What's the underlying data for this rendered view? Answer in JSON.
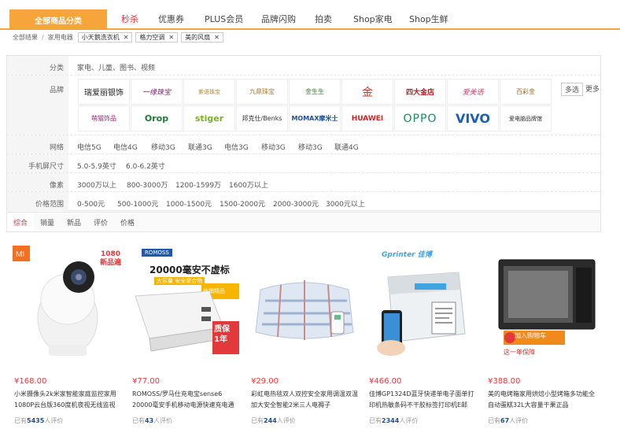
{
  "nav": {
    "all_label": "全部商品分类",
    "items": [
      "秒杀",
      "优惠券",
      "PLUS会员",
      "品牌闪购",
      "拍卖",
      "Shop家电",
      "Shop生鲜"
    ]
  },
  "breadcrumb": {
    "root": "全部结果",
    "category": "家用电器",
    "tags": [
      "小天鹅洗衣机",
      "格力空调",
      "美的风扇"
    ]
  },
  "filters": {
    "category": {
      "label": "分类",
      "options": [
        "家电、儿童、图书、视频"
      ]
    },
    "brand": {
      "label": "品牌",
      "more_select": "多选",
      "more": "更多",
      "brands": [
        "瑞爱丽银饰",
        "一缘珠宝",
        "紫语珠宝",
        "九鼎珠宝",
        "金生生",
        "金",
        "四大金店",
        "爱美语",
        "百彩金",
        "萌猫饰品",
        "Orop",
        "stiger",
        "邦克仕/Benks",
        "MOMAX摩米士",
        "HUAWEI",
        "OPPO",
        "VIVO",
        "爱电脑品牌馆"
      ]
    },
    "network": {
      "label": "网络",
      "options": [
        "电信5G",
        "电信4G",
        "移动3G",
        "联通3G",
        "电信3G",
        "移动3G",
        "移动3G",
        "联通4G"
      ]
    },
    "screen": {
      "label": "手机屏尺寸",
      "options": [
        "5.0-5.9英寸",
        "6.0-6.2英寸"
      ]
    },
    "pixel": {
      "label": "像素",
      "options": [
        "3000万以上",
        "800-3000万",
        "1200-1599万",
        "1600万以上"
      ]
    },
    "price": {
      "label": "价格范围",
      "options": [
        "0-500元",
        "500-1000元",
        "1000-1500元",
        "1500-2000元",
        "2000-3000元",
        "3000元以上"
      ]
    }
  },
  "sort": [
    "综合",
    "销量",
    "新品",
    "评价",
    "价格"
  ],
  "products": [
    {
      "price": "¥168.00",
      "title": "小米摄像头2k米家智能家庭监控家用1080P云台版360度机夜视无线监视",
      "count": "5435",
      "badge": "1080\n新品遍",
      "logo": "MI"
    },
    {
      "price": "¥77.00",
      "title": "ROMOSS/罗马仕充电宝sense6 20000毫安手机移动电源快速充电通用",
      "count": "43",
      "banner1": "20000毫安不虚标",
      "banner2": "大容量 安全聚合物",
      "banner3": "热销精品",
      "banner4": "质保\n1年",
      "logo": "ROMOSS"
    },
    {
      "price": "¥29.00",
      "title": "彩虹电热毯双人双控安全家用调温双温加大安全智能2米三人电褥子",
      "count": "244"
    },
    {
      "price": "¥466.00",
      "title": "佳博GP1324D蓝牙快递单电子面单打印机热敏条码不干胶标签打印机E邮",
      "count": "2344",
      "logo": "Gprinter 佳博"
    },
    {
      "price": "¥388.00",
      "title": "美的电烤箱家用烘焙小型烤箱多功能全自动蛋糕32L大容量干果正品",
      "count": "67",
      "banner1": "加入购物车",
      "banner2": "这一年保障"
    }
  ],
  "review_prefix": "已有",
  "review_suffix": "人评价"
}
